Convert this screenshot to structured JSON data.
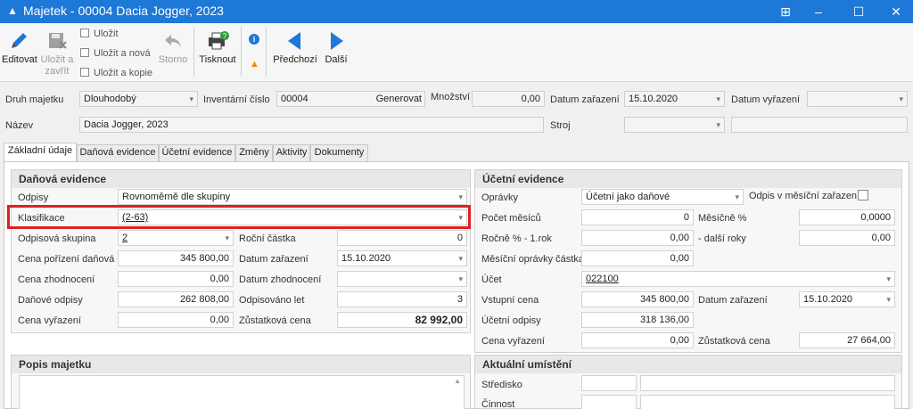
{
  "window": {
    "title": "Majetek - 00004 Dacia Jogger, 2023"
  },
  "toolbar": {
    "edit": "Editovat",
    "save_close": "Uložit a zavřít",
    "save": "Uložit",
    "save_new": "Uložit a nová",
    "save_copy": "Uložit a kopie",
    "cancel": "Storno",
    "print": "Tisknout",
    "prev": "Předchozí",
    "next": "Další"
  },
  "header": {
    "druh_label": "Druh majetku",
    "druh_value": "Dlouhodobý",
    "inv_label": "Inventární číslo",
    "inv_value": "00004",
    "generate": "Generovat",
    "qty_label": "Množství",
    "qty_value": "0,00",
    "date_in_label": "Datum zařazení",
    "date_in_value": "15.10.2020",
    "date_out_label": "Datum vyřazení",
    "date_out_value": "",
    "name_label": "Název",
    "name_value": "Dacia Jogger, 2023",
    "stroj_label": "Stroj",
    "stroj_value": ""
  },
  "tabs": [
    "Základní údaje",
    "Daňová evidence",
    "Účetní evidence",
    "Změny",
    "Aktivity",
    "Dokumenty"
  ],
  "tax": {
    "title": "Daňová evidence",
    "odpisy_label": "Odpisy",
    "odpisy_value": "Rovnoměrně dle skupiny",
    "klas_label": "Klasifikace",
    "klas_value": "(2-63)",
    "skup_label": "Odpisová skupina",
    "skup_value": "2",
    "rocni_label": "Roční částka",
    "rocni_value": "0",
    "cena_por_label": "Cena pořízení daňová",
    "cena_por_value": "345 800,00",
    "dat_zar_label": "Datum zařazení",
    "dat_zar_value": "15.10.2020",
    "cena_zh_label": "Cena zhodnocení",
    "cena_zh_value": "0,00",
    "dat_zh_label": "Datum zhodnocení",
    "dat_zh_value": "",
    "odpisy_dan_label": "Daňové odpisy",
    "odpisy_dan_value": "262 808,00",
    "odp_let_label": "Odpisováno let",
    "odp_let_value": "3",
    "cena_vyr_label": "Cena vyřazení",
    "cena_vyr_value": "0,00",
    "zust_label": "Zůstatková cena",
    "zust_value": "82 992,00"
  },
  "acc": {
    "title": "Účetní evidence",
    "opravky_label": "Oprávky",
    "opravky_value": "Účetní jako daňové",
    "monthly_label": "Odpis v měsíční zařazení",
    "pocet_label": "Počet měsíců",
    "pocet_value": "0",
    "mesicne_label": "Měsíčně %",
    "mesicne_value": "0,0000",
    "rocne_label": "Ročně % - 1.rok",
    "rocne_value": "0,00",
    "dalsi_label": "- další roky",
    "dalsi_value": "0,00",
    "mes_opr_label": "Měsíční oprávky částka",
    "mes_opr_value": "0,00",
    "ucet_label": "Účet",
    "ucet_value": "022100",
    "vstupni_label": "Vstupní cena",
    "vstupni_value": "345 800,00",
    "dat_zar_label": "Datum zařazení",
    "dat_zar_value": "15.10.2020",
    "ucet_odpisy_label": "Účetní odpisy",
    "ucet_odpisy_value": "318 136,00",
    "cena_vyr_label": "Cena vyřazení",
    "cena_vyr_value": "0,00",
    "zust_label": "Zůstatková cena",
    "zust_value": "27 664,00"
  },
  "desc": {
    "title": "Popis majetku"
  },
  "location": {
    "title": "Aktuální umístění",
    "stredisko_label": "Středisko",
    "cinnost_label": "Činnost"
  }
}
